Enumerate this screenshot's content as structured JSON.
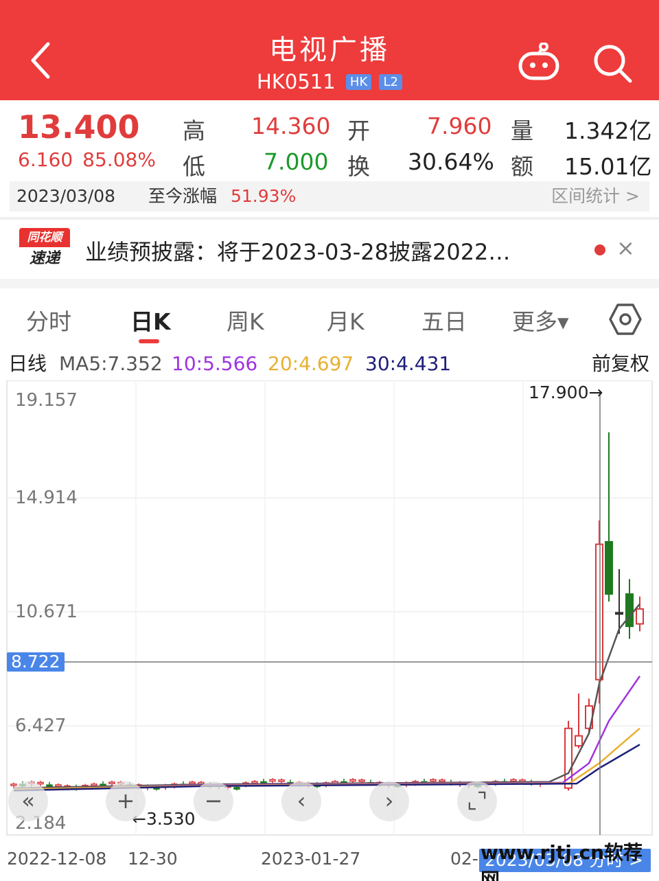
{
  "header": {
    "title": "电视广播",
    "code": "HK0511",
    "tag_market": "HK",
    "tag_level": "L2"
  },
  "quote": {
    "price": "13.400",
    "change": "6.160",
    "change_pct": "85.08%",
    "high_label": "高",
    "high": "14.360",
    "low_label": "低",
    "low": "7.000",
    "open_label": "开",
    "open": "7.960",
    "turnover_label": "换",
    "turnover": "30.64%",
    "volume_label": "量",
    "volume": "1.342亿",
    "amount_label": "额",
    "amount": "15.01亿"
  },
  "infobar": {
    "date": "2023/03/08",
    "since_label": "至今涨幅",
    "since_pct": "51.93%",
    "stat_label": "区间统计 >"
  },
  "news": {
    "logo_top": "同花顺",
    "logo_bottom": "速递",
    "text": "业绩预披露：将于2023-03-28披露2022…",
    "close": "×"
  },
  "tabs": {
    "items": [
      "分时",
      "日K",
      "周K",
      "月K",
      "五日",
      "更多▾"
    ],
    "active": "日K"
  },
  "ma": {
    "line_label": "日线",
    "ma5": "MA5:7.352",
    "ma10": "10:5.566",
    "ma20": "20:4.697",
    "ma30": "30:4.431",
    "adjust": "前复权",
    "colors": {
      "ma5": "#555555",
      "ma10": "#a033e0",
      "ma20": "#e8b030",
      "ma30": "#1e1e7a",
      "up": "#d8383c",
      "down": "#1f7a1f"
    }
  },
  "chart_data": {
    "type": "candlestick",
    "price_ticks": [
      "19.157",
      "14.914",
      "10.671",
      "6.427",
      "2.184"
    ],
    "crosshair_price": "8.722",
    "high_mark": "17.900→",
    "low_mark": "←3.530",
    "x_dates": [
      "2022-12-08",
      "12-30",
      "2023-01-27",
      "02-"
    ],
    "selected_date": "2023/03/08 分时 >",
    "ylim": [
      2.184,
      19.157
    ],
    "recent_candles": [
      {
        "o": 3.6,
        "h": 6.3,
        "l": 3.5,
        "c": 6.0,
        "dir": "up"
      },
      {
        "o": 5.3,
        "h": 7.4,
        "l": 5.2,
        "c": 5.7,
        "dir": "up"
      },
      {
        "o": 6.0,
        "h": 7.2,
        "l": 5.8,
        "c": 6.9,
        "dir": "up"
      },
      {
        "o": 7.96,
        "h": 14.36,
        "l": 7.0,
        "c": 13.4,
        "dir": "up"
      },
      {
        "o": 13.5,
        "h": 17.9,
        "l": 11.1,
        "c": 11.4,
        "dir": "down"
      },
      {
        "o": 10.6,
        "h": 12.4,
        "l": 9.8,
        "c": 10.65,
        "dir": "flat"
      },
      {
        "o": 11.4,
        "h": 12.0,
        "l": 9.6,
        "c": 10.1,
        "dir": "down"
      },
      {
        "o": 10.2,
        "h": 11.3,
        "l": 9.9,
        "c": 10.8,
        "dir": "up"
      }
    ]
  },
  "controls": [
    "«",
    "+",
    "−",
    "‹",
    "›",
    "⌞⌝"
  ],
  "watermark": "www.rjtj.cn软荐网"
}
